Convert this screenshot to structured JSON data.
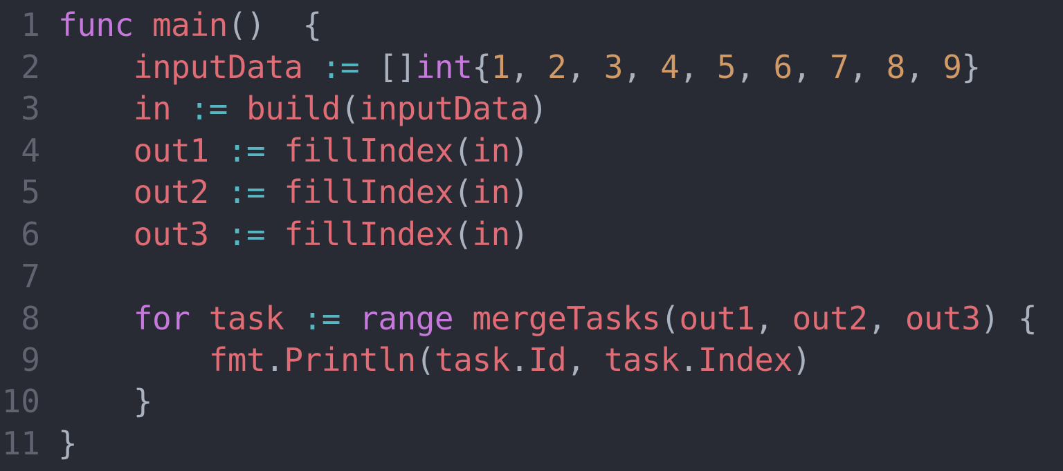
{
  "editor": {
    "language": "Go",
    "colors": {
      "background": "#282b33",
      "line_number": "#5f6470",
      "keyword": "#c678dd",
      "identifier": "#e06c75",
      "number": "#d19a66",
      "operator": "#56b6c2",
      "punctuation": "#abb2bf"
    },
    "lines": [
      {
        "num": "1",
        "tokens": [
          [
            "kw",
            "func"
          ],
          [
            "pl",
            " "
          ],
          [
            "fn",
            "main"
          ],
          [
            "pl",
            "()  {"
          ]
        ]
      },
      {
        "num": "2",
        "tokens": [
          [
            "pl",
            "    "
          ],
          [
            "id",
            "inputData"
          ],
          [
            "pl",
            " "
          ],
          [
            "op",
            ":="
          ],
          [
            "pl",
            " []"
          ],
          [
            "kw",
            "int"
          ],
          [
            "pl",
            "{"
          ],
          [
            "num",
            "1"
          ],
          [
            "pl",
            ", "
          ],
          [
            "num",
            "2"
          ],
          [
            "pl",
            ", "
          ],
          [
            "num",
            "3"
          ],
          [
            "pl",
            ", "
          ],
          [
            "num",
            "4"
          ],
          [
            "pl",
            ", "
          ],
          [
            "num",
            "5"
          ],
          [
            "pl",
            ", "
          ],
          [
            "num",
            "6"
          ],
          [
            "pl",
            ", "
          ],
          [
            "num",
            "7"
          ],
          [
            "pl",
            ", "
          ],
          [
            "num",
            "8"
          ],
          [
            "pl",
            ", "
          ],
          [
            "num",
            "9"
          ],
          [
            "pl",
            "}"
          ]
        ]
      },
      {
        "num": "3",
        "tokens": [
          [
            "pl",
            "    "
          ],
          [
            "id",
            "in"
          ],
          [
            "pl",
            " "
          ],
          [
            "op",
            ":="
          ],
          [
            "pl",
            " "
          ],
          [
            "fn",
            "build"
          ],
          [
            "pl",
            "("
          ],
          [
            "id",
            "inputData"
          ],
          [
            "pl",
            ")"
          ]
        ]
      },
      {
        "num": "4",
        "tokens": [
          [
            "pl",
            "    "
          ],
          [
            "id",
            "out1"
          ],
          [
            "pl",
            " "
          ],
          [
            "op",
            ":="
          ],
          [
            "pl",
            " "
          ],
          [
            "fn",
            "fillIndex"
          ],
          [
            "pl",
            "("
          ],
          [
            "id",
            "in"
          ],
          [
            "pl",
            ")"
          ]
        ]
      },
      {
        "num": "5",
        "tokens": [
          [
            "pl",
            "    "
          ],
          [
            "id",
            "out2"
          ],
          [
            "pl",
            " "
          ],
          [
            "op",
            ":="
          ],
          [
            "pl",
            " "
          ],
          [
            "fn",
            "fillIndex"
          ],
          [
            "pl",
            "("
          ],
          [
            "id",
            "in"
          ],
          [
            "pl",
            ")"
          ]
        ]
      },
      {
        "num": "6",
        "tokens": [
          [
            "pl",
            "    "
          ],
          [
            "id",
            "out3"
          ],
          [
            "pl",
            " "
          ],
          [
            "op",
            ":="
          ],
          [
            "pl",
            " "
          ],
          [
            "fn",
            "fillIndex"
          ],
          [
            "pl",
            "("
          ],
          [
            "id",
            "in"
          ],
          [
            "pl",
            ")"
          ]
        ]
      },
      {
        "num": "7",
        "tokens": []
      },
      {
        "num": "8",
        "tokens": [
          [
            "pl",
            "    "
          ],
          [
            "kw",
            "for"
          ],
          [
            "pl",
            " "
          ],
          [
            "id",
            "task"
          ],
          [
            "pl",
            " "
          ],
          [
            "op",
            ":="
          ],
          [
            "pl",
            " "
          ],
          [
            "kw",
            "range"
          ],
          [
            "pl",
            " "
          ],
          [
            "fn",
            "mergeTasks"
          ],
          [
            "pl",
            "("
          ],
          [
            "id",
            "out1"
          ],
          [
            "pl",
            ", "
          ],
          [
            "id",
            "out2"
          ],
          [
            "pl",
            ", "
          ],
          [
            "id",
            "out3"
          ],
          [
            "pl",
            ") {"
          ]
        ]
      },
      {
        "num": "9",
        "tokens": [
          [
            "pl",
            "        "
          ],
          [
            "id",
            "fmt"
          ],
          [
            "pl",
            "."
          ],
          [
            "fn",
            "Println"
          ],
          [
            "pl",
            "("
          ],
          [
            "id",
            "task"
          ],
          [
            "pl",
            "."
          ],
          [
            "id",
            "Id"
          ],
          [
            "pl",
            ", "
          ],
          [
            "id",
            "task"
          ],
          [
            "pl",
            "."
          ],
          [
            "id",
            "Index"
          ],
          [
            "pl",
            ")"
          ]
        ]
      },
      {
        "num": "10",
        "tokens": [
          [
            "pl",
            "    }"
          ]
        ]
      },
      {
        "num": "11",
        "tokens": [
          [
            "pl",
            "}"
          ]
        ]
      }
    ]
  }
}
